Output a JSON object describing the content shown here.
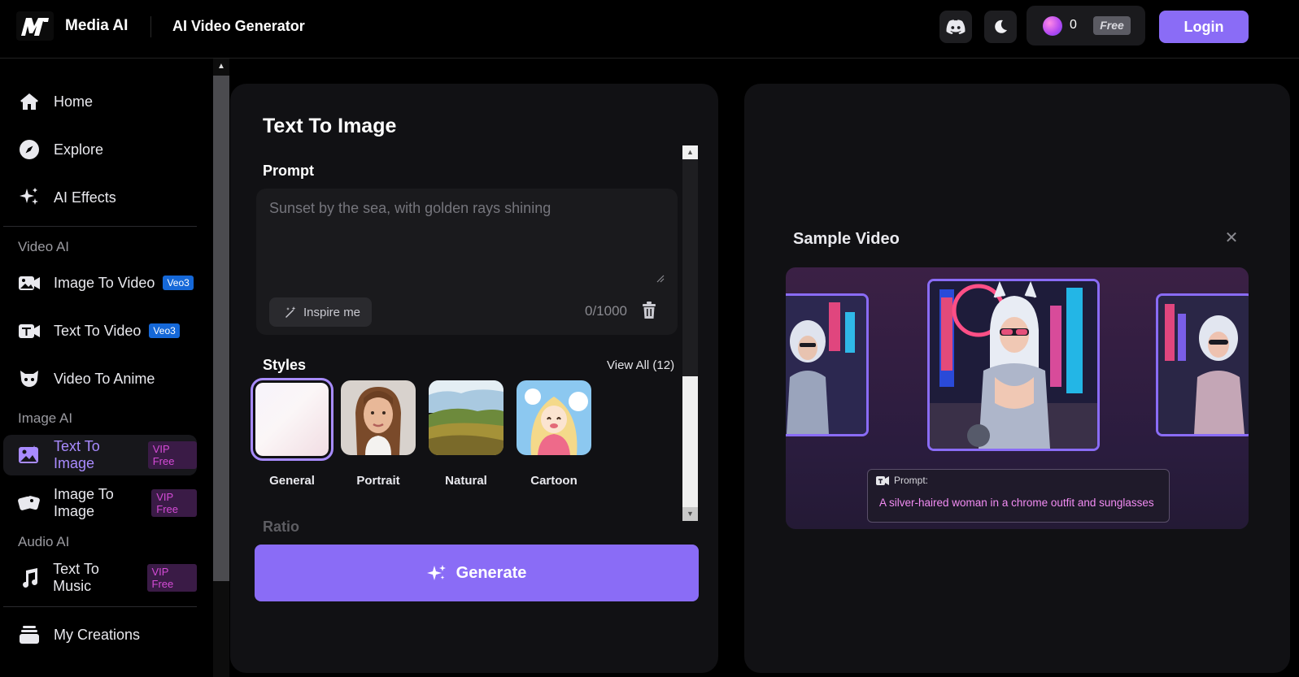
{
  "header": {
    "brand": "Media AI",
    "page_heading": "AI Video Generator",
    "credits_count": "0",
    "credits_badge": "Free",
    "login_label": "Login",
    "icons": [
      "discord-icon",
      "moon-icon",
      "gem-icon"
    ]
  },
  "sidebar": {
    "items": [
      {
        "label": "Home",
        "icon": "home-icon"
      },
      {
        "label": "Explore",
        "icon": "compass-icon"
      },
      {
        "label": "AI Effects",
        "icon": "sparkles-icon"
      }
    ],
    "sections": [
      {
        "title": "Video AI",
        "items": [
          {
            "label": "Image To Video",
            "badge": "Veo3",
            "icon": "image-video-icon"
          },
          {
            "label": "Text To Video",
            "badge": "Veo3",
            "icon": "text-video-icon"
          },
          {
            "label": "Video To Anime",
            "icon": "anime-icon"
          }
        ]
      },
      {
        "title": "Image AI",
        "items": [
          {
            "label": "Text To Image",
            "badge": "VIP Free",
            "icon": "text-image-icon",
            "active": true
          },
          {
            "label": "Image To Image",
            "badge": "VIP Free",
            "icon": "image-image-icon"
          }
        ]
      },
      {
        "title": "Audio AI",
        "items": [
          {
            "label": "Text To Music",
            "badge": "VIP Free",
            "icon": "music-icon"
          }
        ]
      }
    ],
    "bottom": {
      "label": "My Creations",
      "icon": "stack-icon"
    }
  },
  "panel": {
    "title": "Text To Image",
    "prompt_label": "Prompt",
    "prompt_placeholder": "Sunset by the sea, with golden rays shining",
    "inspire_label": "Inspire me",
    "char_counter": "0/1000",
    "styles_label": "Styles",
    "view_all": "View All (12)",
    "styles": [
      {
        "name": "General",
        "selected": true
      },
      {
        "name": "Portrait"
      },
      {
        "name": "Natural"
      },
      {
        "name": "Cartoon"
      }
    ],
    "ratio_label": "Ratio",
    "generate_label": "Generate"
  },
  "preview": {
    "title": "Sample Video",
    "prompt_header": "Prompt:",
    "prompt_text": "A silver-haired woman in a chrome outfit and sunglasses"
  },
  "colors": {
    "accent": "#8a6cf6",
    "active_text": "#a98bff",
    "veo_badge": "#1568d8",
    "vip_text": "#d44bd6"
  }
}
